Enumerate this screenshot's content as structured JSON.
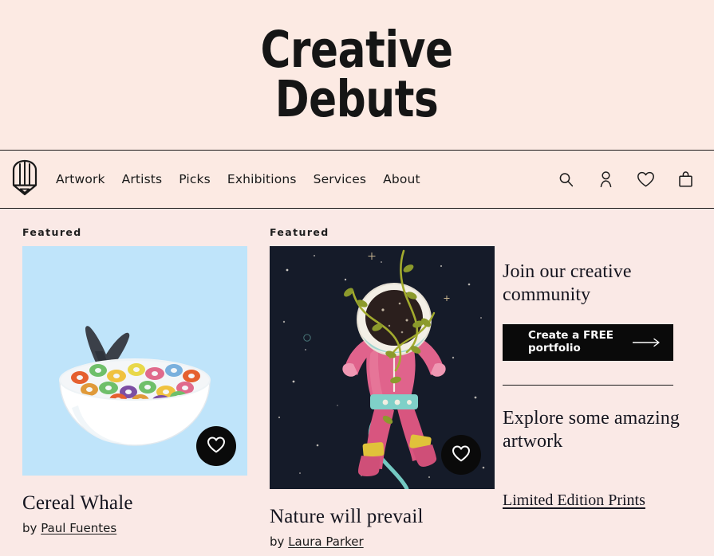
{
  "masthead": {
    "title_line1": "Creative",
    "title_line2": "Debuts",
    "bg_color": "#fceae3"
  },
  "nav": {
    "logo_icon": "pencil-logo-icon",
    "links": [
      {
        "label": "Artwork"
      },
      {
        "label": "Artists"
      },
      {
        "label": "Picks"
      },
      {
        "label": "Exhibitions"
      },
      {
        "label": "Services"
      },
      {
        "label": "About"
      }
    ],
    "actions": [
      {
        "icon": "search-icon"
      },
      {
        "icon": "user-icon"
      },
      {
        "icon": "heart-icon"
      },
      {
        "icon": "shopping-bag-icon"
      }
    ]
  },
  "cards": [
    {
      "badge": "Featured",
      "title": "Cereal Whale",
      "by_prefix": "by",
      "artist": "Paul Fuentes",
      "favorite_icon": "heart-icon",
      "image_bg": "#bfe4fa",
      "image_alt": "cereal-whale-artwork"
    },
    {
      "badge": "Featured",
      "title": "Nature will prevail",
      "by_prefix": "by",
      "artist": "Laura Parker",
      "favorite_icon": "heart-icon",
      "image_bg": "#161c2b",
      "image_alt": "astronaut-artwork"
    }
  ],
  "promo": {
    "heading_1": "Join our creative community",
    "cta_label": "Create a FREE portfolio",
    "cta_icon": "arrow-right-icon",
    "cta_bg": "#0a0a0a",
    "heading_2": "Explore some amazing artwork",
    "link_label": "Limited Edition Prints"
  }
}
